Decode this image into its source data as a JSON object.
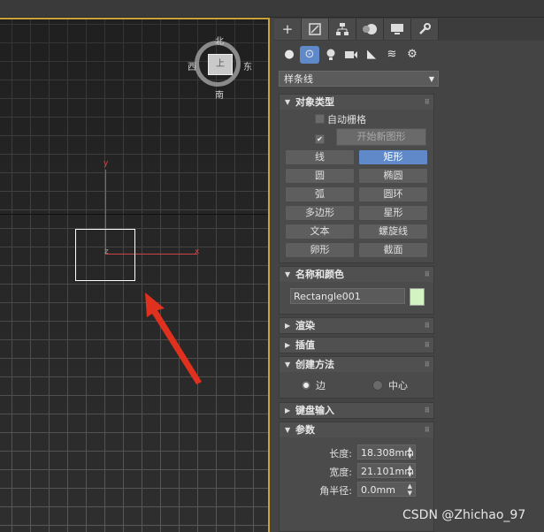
{
  "viewcube": {
    "n": "北",
    "s": "南",
    "e": "东",
    "w": "西",
    "face": "上"
  },
  "axes": {
    "x": "x",
    "y": "y",
    "z": "z"
  },
  "panel": {
    "tabs": [
      "+",
      "◰",
      "⛳",
      "●",
      "▭",
      "🔧"
    ],
    "sub_icons": [
      "●",
      "⊙",
      "💡",
      "■",
      "◣",
      "≋",
      "⚙"
    ],
    "category_dropdown": "样条线",
    "object_type": {
      "title": "对象类型",
      "autogrid_label": "自动栅格",
      "start_new_shape_label": "开始新图形",
      "buttons": [
        "线",
        "矩形",
        "圆",
        "椭圆",
        "弧",
        "圆环",
        "多边形",
        "星形",
        "文本",
        "螺旋线",
        "卵形",
        "截面"
      ],
      "active_button": "矩形"
    },
    "name_color": {
      "title": "名称和颜色",
      "name_value": "Rectangle001",
      "color": "#d3f3c2"
    },
    "render": {
      "title": "渲染"
    },
    "interpolation": {
      "title": "插值"
    },
    "creation_method": {
      "title": "创建方法",
      "option_edge": "边",
      "option_center": "中心"
    },
    "keyboard_entry": {
      "title": "键盘输入"
    },
    "parameters": {
      "title": "参数",
      "length_label": "长度:",
      "length_value": "18.308mm",
      "width_label": "宽度:",
      "width_value": "21.101mm",
      "corner_label": "角半径:",
      "corner_value": "0.0mm"
    }
  },
  "watermark": "CSDN @Zhichao_97",
  "colors": {
    "accent": "#5f89c8",
    "viewport_border": "#c8a23a",
    "arrow": "#e0311f"
  }
}
